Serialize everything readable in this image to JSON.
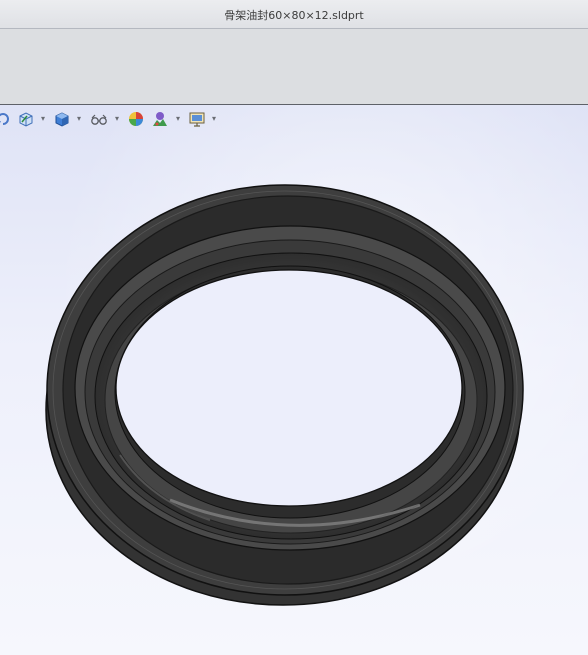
{
  "window": {
    "title": "骨架油封60×80×12.sldprt"
  },
  "heads_up_toolbar": {
    "items": [
      {
        "icon": "rotate-view-icon"
      },
      {
        "icon": "view-orientation-icon",
        "has_dropdown": true
      },
      {
        "icon": "display-style-icon",
        "has_dropdown": true
      },
      {
        "icon": "hide-show-items-icon",
        "has_dropdown": true
      },
      {
        "icon": "edit-appearance-icon"
      },
      {
        "icon": "apply-scene-icon",
        "has_dropdown": true
      },
      {
        "icon": "view-settings-icon",
        "has_dropdown": true
      }
    ]
  },
  "graphics_area": {
    "background_top": "#dfe3f6",
    "background_bottom": "#f6f7fd",
    "model": "oil-seal-ring",
    "model_color": "#3a3a3a"
  }
}
